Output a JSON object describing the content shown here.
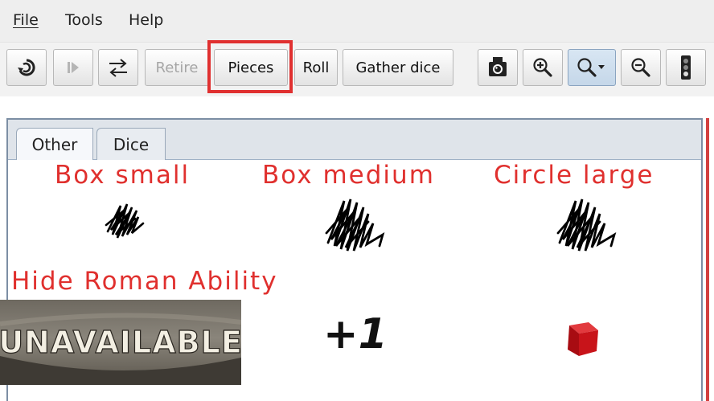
{
  "menubar": {
    "items": [
      {
        "label": "File",
        "mnemonic": "F"
      },
      {
        "label": "Tools",
        "mnemonic": "T"
      },
      {
        "label": "Help",
        "mnemonic": "H"
      }
    ]
  },
  "toolbar": {
    "retire_label": "Retire",
    "pieces_label": "Pieces",
    "roll_label": "Roll",
    "gather_label": "Gather dice",
    "icons": [
      "undo-icon",
      "step-forward-icon",
      "swap-arrows-icon",
      "camera-icon",
      "zoom-in-icon",
      "zoom-menu-icon",
      "zoom-out-icon",
      "traffic-light-icon"
    ]
  },
  "tabs": {
    "other": "Other",
    "dice": "Dice"
  },
  "pieces": {
    "box_small": "Box small",
    "box_medium": "Box medium",
    "circle_large": "Circle large",
    "hide_roman": "Hide Roman Ability",
    "unavailable_text": "UNAVAILABLE",
    "plus_one": "+1"
  },
  "colors": {
    "label_red": "#e0302e",
    "highlight_red": "#e03030",
    "cube_red": "#c8141a"
  }
}
